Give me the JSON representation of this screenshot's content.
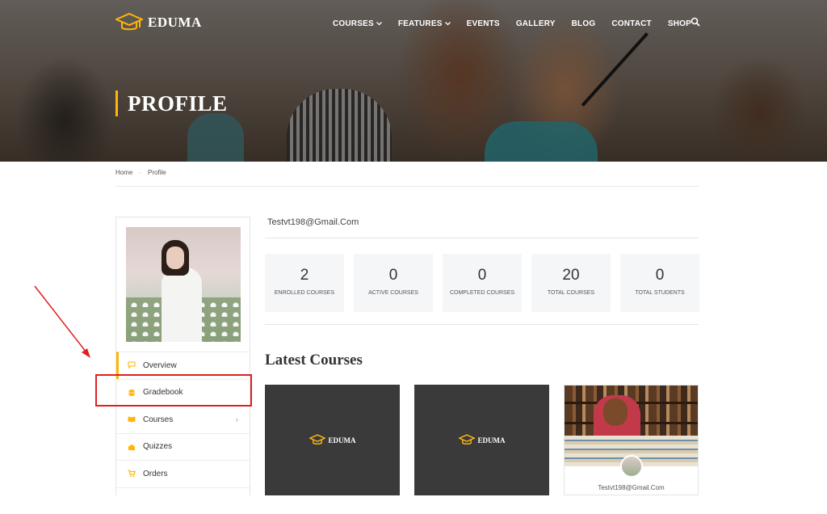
{
  "header": {
    "logo_text": "EDUMA",
    "nav": [
      {
        "label": "COURSES",
        "has_dropdown": true
      },
      {
        "label": "FEATURES",
        "has_dropdown": true
      },
      {
        "label": "EVENTS",
        "has_dropdown": false
      },
      {
        "label": "GALLERY",
        "has_dropdown": false
      },
      {
        "label": "BLOG",
        "has_dropdown": false
      },
      {
        "label": "CONTACT",
        "has_dropdown": false
      },
      {
        "label": "SHOP",
        "has_dropdown": false
      }
    ],
    "search_icon": "search-icon"
  },
  "hero": {
    "title": "PROFILE"
  },
  "breadcrumb": {
    "home": "Home",
    "current": "Profile"
  },
  "sidebar": {
    "menu": [
      {
        "label": "Overview",
        "icon": "chat-icon"
      },
      {
        "label": "Gradebook",
        "icon": "database-icon"
      },
      {
        "label": "Courses",
        "icon": "book-icon"
      },
      {
        "label": "Quizzes",
        "icon": "puzzle-icon"
      },
      {
        "label": "Orders",
        "icon": "cart-icon"
      }
    ]
  },
  "profile": {
    "email": "Testvt198@Gmail.Com",
    "stats": [
      {
        "value": "2",
        "label": "ENROLLED COURSES"
      },
      {
        "value": "0",
        "label": "ACTIVE COURSES"
      },
      {
        "value": "0",
        "label": "COMPLETED COURSES"
      },
      {
        "value": "20",
        "label": "TOTAL COURSES"
      },
      {
        "value": "0",
        "label": "TOTAL STUDENTS"
      }
    ]
  },
  "latest": {
    "heading": "Latest Courses",
    "cards": [
      {
        "logo_text": "EDUMA"
      },
      {
        "logo_text": "EDUMA"
      },
      {
        "author_email": "Testvt198@Gmail.Com"
      }
    ]
  },
  "colors": {
    "accent": "#ffb606",
    "annotation": "#e02020",
    "card_dark": "#3a3a3a"
  }
}
